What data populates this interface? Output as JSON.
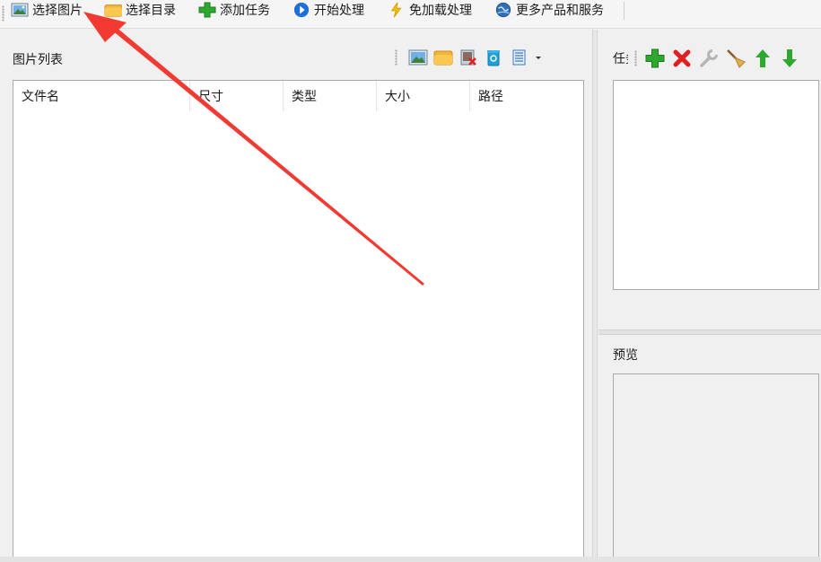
{
  "toolbar": {
    "select_image": "选择图片",
    "select_folder": "选择目录",
    "add_task": "添加任务",
    "start_process": "开始处理",
    "no_load_process": "免加载处理",
    "more_products": "更多产品和服务"
  },
  "image_list": {
    "title": "图片列表",
    "columns": [
      "文件名",
      "尺寸",
      "类型",
      "大小",
      "路径"
    ]
  },
  "task_panel": {
    "title": "任务"
  },
  "preview_panel": {
    "title": "预览"
  },
  "icons": {
    "select_image": "image-icon",
    "select_folder": "folder-icon",
    "add_task": "plus-icon",
    "start_process": "play-icon",
    "no_load_process": "lightning-icon",
    "more_products": "globe-icon"
  },
  "colors": {
    "annotation_arrow": "#f03a32",
    "add_green": "#2ea82e",
    "delete_red": "#e02020",
    "play_blue": "#1e6fd9"
  }
}
